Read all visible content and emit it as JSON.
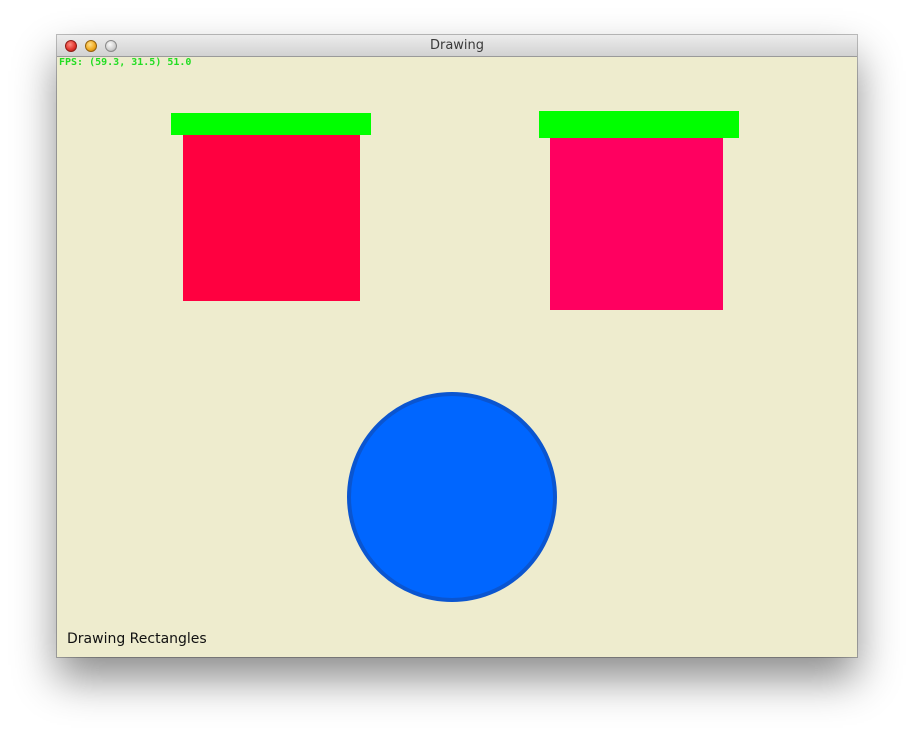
{
  "window": {
    "title": "Drawing"
  },
  "hud": {
    "fps_text": "FPS: (59.3, 31.5) 51.0",
    "fps_color": "#22dd22"
  },
  "scene": {
    "background_color": "#eeecce",
    "left_bar_color": "#00ff00",
    "left_square_color": "#ff0040",
    "right_bar_color": "#00ff00",
    "right_square_color": "#ff0060",
    "circle_fill_color": "#0066ff",
    "circle_border_color": "#0a55d0"
  },
  "caption": {
    "text": "Drawing Rectangles"
  },
  "icons": {
    "close": "close-button-icon",
    "minimize": "minimize-button-icon",
    "zoom": "zoom-button-icon"
  }
}
